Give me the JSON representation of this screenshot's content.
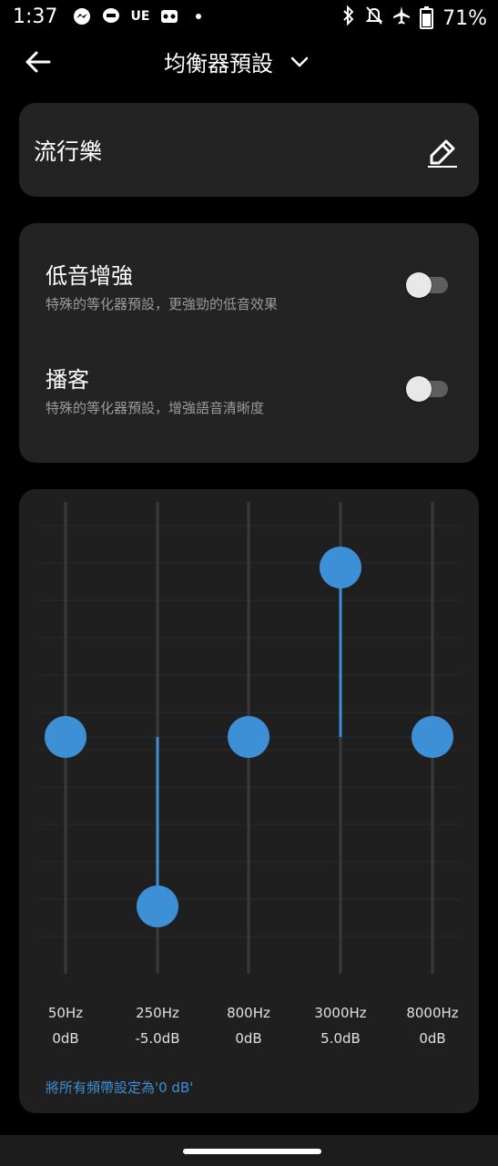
{
  "status_bar": {
    "time": "1:37",
    "app_icons": [
      "messenger-icon",
      "line-icon",
      "ue-icon",
      "voicemail-icon",
      "dot-icon"
    ],
    "ue_label": "UE",
    "battery_percent": "71%"
  },
  "app_bar": {
    "title": "均衡器預設"
  },
  "preset": {
    "name": "流行樂"
  },
  "toggles": [
    {
      "title": "低音增強",
      "description": "特殊的等化器預設，更強勁的低音效果",
      "on": false
    },
    {
      "title": "播客",
      "description": "特殊的等化器預設，增強語音清晰度",
      "on": false
    }
  ],
  "equalizer": {
    "db_range": [
      -10,
      10
    ],
    "bands": [
      {
        "freq": "50Hz",
        "gain_label": "0dB",
        "gain": 0
      },
      {
        "freq": "250Hz",
        "gain_label": "-5.0dB",
        "gain": -5
      },
      {
        "freq": "800Hz",
        "gain_label": "0dB",
        "gain": 0
      },
      {
        "freq": "3000Hz",
        "gain_label": "5.0dB",
        "gain": 5
      },
      {
        "freq": "8000Hz",
        "gain_label": "0dB",
        "gain": 0
      }
    ],
    "reset_label": "將所有頻帶設定為'0 dB'"
  },
  "colors": {
    "accent": "#3d8fd6",
    "card": "#232323",
    "background": "#000000"
  }
}
